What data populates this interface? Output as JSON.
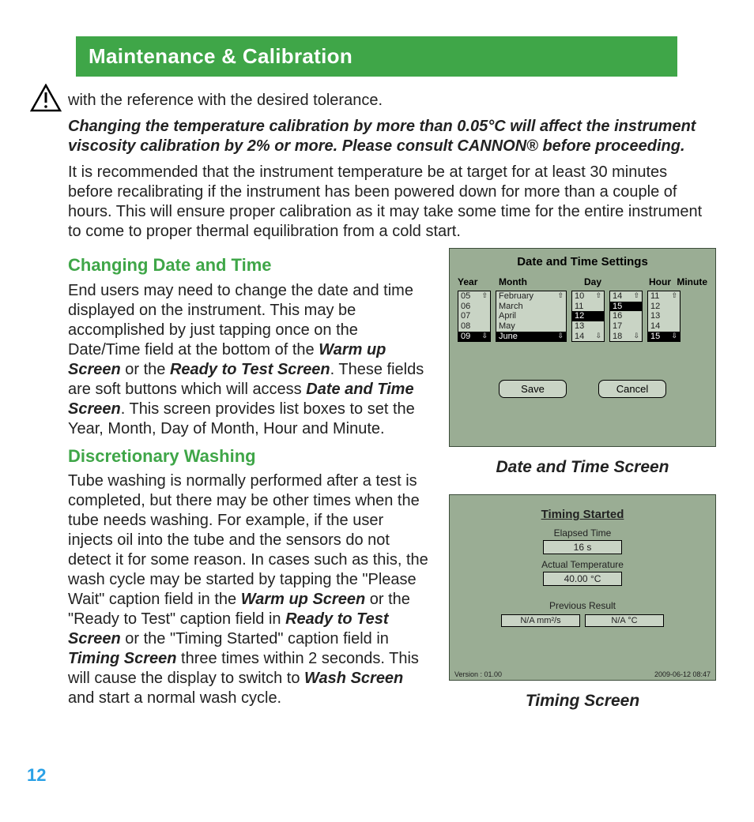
{
  "header_title": "Maintenance & Calibration",
  "intro_line": "with the reference with the desired tolerance.",
  "warning_para": "Changing the temperature calibration by more than 0.05°C will affect the instrument viscosity calibration by 2% or more. Please consult CANNON® before proceeding.",
  "recommend_para": "It is recommended that the instrument temperature be at target for at least 30 minutes before recalibrating if the instrument has been powered down for more than a couple of hours. This will ensure proper calibration as it may take some time for the entire instrument to come to proper thermal equilibration from a cold start.",
  "section_changing_title": "Changing Date and Time",
  "changing_para": {
    "pre1": "End users may need to change the date and time displayed on the instrument. This may be accomplished by just tapping once on the Date/Time field at the bottom of the ",
    "b1": "Warm up Screen",
    "mid1": " or the ",
    "b2": "Ready to Test Screen",
    "mid2": ". These fields are soft buttons which will access ",
    "b3": "Date and Time Screen",
    "post": ". This screen provides list boxes to set the Year, Month, Day of Month, Hour and Minute."
  },
  "section_discretionary_title": "Discretionary Washing",
  "discretionary_para": {
    "pre": "Tube washing is normally performed after a test is completed, but there may be other times when the tube needs washing. For example, if the user injects oil into the tube and the sensors do not detect it for some reason. In cases such as this, the wash cycle may be started by tapping the \"Please Wait\" caption field in the ",
    "b1": "Warm up Screen",
    "mid1": " or the \"Ready to Test\" caption field in ",
    "b2": "Ready to Test Screen",
    "mid2": " or the \"Timing Started\" caption field in ",
    "b3": "Timing Screen",
    "mid3": " three times within 2 seconds. This will cause the display to switch to ",
    "b4": "Wash Screen",
    "post": " and start a normal wash cycle."
  },
  "dt_caption": "Date and Time Screen",
  "timing_caption": "Timing Screen",
  "page_number": "12",
  "dt_screen": {
    "title": "Date and Time Settings",
    "headers": [
      "Year",
      "Month",
      "Day",
      "Hour",
      "Minute"
    ],
    "year": [
      "05",
      "06",
      "07",
      "08",
      "09"
    ],
    "year_sel": 4,
    "month": [
      "February",
      "March",
      "April",
      "May",
      "June"
    ],
    "month_sel": 4,
    "day": [
      "10",
      "11",
      "12",
      "13",
      "14"
    ],
    "day_sel": 2,
    "hour": [
      "14",
      "15",
      "16",
      "17",
      "18"
    ],
    "hour_sel": 1,
    "minute": [
      "11",
      "12",
      "13",
      "14",
      "15"
    ],
    "minute_sel": 4,
    "save": "Save",
    "cancel": "Cancel"
  },
  "timing_screen": {
    "title": "Timing Started",
    "elapsed_label": "Elapsed Time",
    "elapsed_value": "16 s",
    "actual_label": "Actual Temperature",
    "actual_value": "40.00 °C",
    "previous_label": "Previous Result",
    "prev_left": "N/A mm²/s",
    "prev_right": "N/A °C",
    "version": "Version : 01.00",
    "datetime": "2009-06-12 08:47"
  }
}
